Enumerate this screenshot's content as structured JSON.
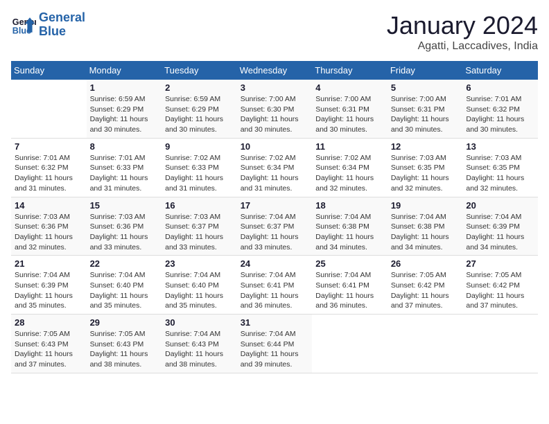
{
  "header": {
    "logo_line1": "General",
    "logo_line2": "Blue",
    "month": "January 2024",
    "location": "Agatti, Laccadives, India"
  },
  "weekdays": [
    "Sunday",
    "Monday",
    "Tuesday",
    "Wednesday",
    "Thursday",
    "Friday",
    "Saturday"
  ],
  "weeks": [
    [
      {
        "day": "",
        "info": ""
      },
      {
        "day": "1",
        "info": "Sunrise: 6:59 AM\nSunset: 6:29 PM\nDaylight: 11 hours\nand 30 minutes."
      },
      {
        "day": "2",
        "info": "Sunrise: 6:59 AM\nSunset: 6:29 PM\nDaylight: 11 hours\nand 30 minutes."
      },
      {
        "day": "3",
        "info": "Sunrise: 7:00 AM\nSunset: 6:30 PM\nDaylight: 11 hours\nand 30 minutes."
      },
      {
        "day": "4",
        "info": "Sunrise: 7:00 AM\nSunset: 6:31 PM\nDaylight: 11 hours\nand 30 minutes."
      },
      {
        "day": "5",
        "info": "Sunrise: 7:00 AM\nSunset: 6:31 PM\nDaylight: 11 hours\nand 30 minutes."
      },
      {
        "day": "6",
        "info": "Sunrise: 7:01 AM\nSunset: 6:32 PM\nDaylight: 11 hours\nand 30 minutes."
      }
    ],
    [
      {
        "day": "7",
        "info": "Sunrise: 7:01 AM\nSunset: 6:32 PM\nDaylight: 11 hours\nand 31 minutes."
      },
      {
        "day": "8",
        "info": "Sunrise: 7:01 AM\nSunset: 6:33 PM\nDaylight: 11 hours\nand 31 minutes."
      },
      {
        "day": "9",
        "info": "Sunrise: 7:02 AM\nSunset: 6:33 PM\nDaylight: 11 hours\nand 31 minutes."
      },
      {
        "day": "10",
        "info": "Sunrise: 7:02 AM\nSunset: 6:34 PM\nDaylight: 11 hours\nand 31 minutes."
      },
      {
        "day": "11",
        "info": "Sunrise: 7:02 AM\nSunset: 6:34 PM\nDaylight: 11 hours\nand 32 minutes."
      },
      {
        "day": "12",
        "info": "Sunrise: 7:03 AM\nSunset: 6:35 PM\nDaylight: 11 hours\nand 32 minutes."
      },
      {
        "day": "13",
        "info": "Sunrise: 7:03 AM\nSunset: 6:35 PM\nDaylight: 11 hours\nand 32 minutes."
      }
    ],
    [
      {
        "day": "14",
        "info": "Sunrise: 7:03 AM\nSunset: 6:36 PM\nDaylight: 11 hours\nand 32 minutes."
      },
      {
        "day": "15",
        "info": "Sunrise: 7:03 AM\nSunset: 6:36 PM\nDaylight: 11 hours\nand 33 minutes."
      },
      {
        "day": "16",
        "info": "Sunrise: 7:03 AM\nSunset: 6:37 PM\nDaylight: 11 hours\nand 33 minutes."
      },
      {
        "day": "17",
        "info": "Sunrise: 7:04 AM\nSunset: 6:37 PM\nDaylight: 11 hours\nand 33 minutes."
      },
      {
        "day": "18",
        "info": "Sunrise: 7:04 AM\nSunset: 6:38 PM\nDaylight: 11 hours\nand 34 minutes."
      },
      {
        "day": "19",
        "info": "Sunrise: 7:04 AM\nSunset: 6:38 PM\nDaylight: 11 hours\nand 34 minutes."
      },
      {
        "day": "20",
        "info": "Sunrise: 7:04 AM\nSunset: 6:39 PM\nDaylight: 11 hours\nand 34 minutes."
      }
    ],
    [
      {
        "day": "21",
        "info": "Sunrise: 7:04 AM\nSunset: 6:39 PM\nDaylight: 11 hours\nand 35 minutes."
      },
      {
        "day": "22",
        "info": "Sunrise: 7:04 AM\nSunset: 6:40 PM\nDaylight: 11 hours\nand 35 minutes."
      },
      {
        "day": "23",
        "info": "Sunrise: 7:04 AM\nSunset: 6:40 PM\nDaylight: 11 hours\nand 35 minutes."
      },
      {
        "day": "24",
        "info": "Sunrise: 7:04 AM\nSunset: 6:41 PM\nDaylight: 11 hours\nand 36 minutes."
      },
      {
        "day": "25",
        "info": "Sunrise: 7:04 AM\nSunset: 6:41 PM\nDaylight: 11 hours\nand 36 minutes."
      },
      {
        "day": "26",
        "info": "Sunrise: 7:05 AM\nSunset: 6:42 PM\nDaylight: 11 hours\nand 37 minutes."
      },
      {
        "day": "27",
        "info": "Sunrise: 7:05 AM\nSunset: 6:42 PM\nDaylight: 11 hours\nand 37 minutes."
      }
    ],
    [
      {
        "day": "28",
        "info": "Sunrise: 7:05 AM\nSunset: 6:43 PM\nDaylight: 11 hours\nand 37 minutes."
      },
      {
        "day": "29",
        "info": "Sunrise: 7:05 AM\nSunset: 6:43 PM\nDaylight: 11 hours\nand 38 minutes."
      },
      {
        "day": "30",
        "info": "Sunrise: 7:04 AM\nSunset: 6:43 PM\nDaylight: 11 hours\nand 38 minutes."
      },
      {
        "day": "31",
        "info": "Sunrise: 7:04 AM\nSunset: 6:44 PM\nDaylight: 11 hours\nand 39 minutes."
      },
      {
        "day": "",
        "info": ""
      },
      {
        "day": "",
        "info": ""
      },
      {
        "day": "",
        "info": ""
      }
    ]
  ]
}
